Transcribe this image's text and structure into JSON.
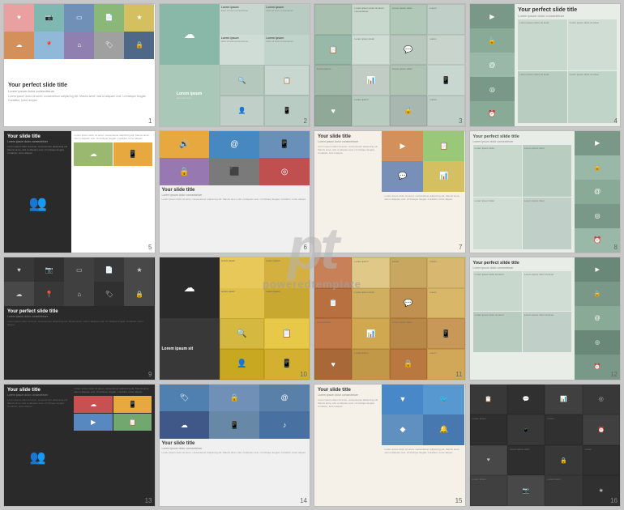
{
  "watermark": {
    "logo": "pt",
    "text": "poweredtemplate"
  },
  "slides": [
    {
      "num": "1",
      "title": "Your perfect slide title",
      "subtitle": "Lorem ipsum dolor consectetuer",
      "type": "icon-title"
    },
    {
      "num": "2",
      "title": "",
      "subtitle": "",
      "type": "cloud-text"
    },
    {
      "num": "3",
      "title": "",
      "subtitle": "",
      "type": "grid-icons"
    },
    {
      "num": "4",
      "title": "Your perfect slide title",
      "subtitle": "Lorem ipsum dolor consectetuer",
      "type": "vert-icon-title"
    },
    {
      "num": "5",
      "title": "Your slide title",
      "subtitle": "Lorem ipsum dolor consectetuer",
      "type": "two-col-dark"
    },
    {
      "num": "6",
      "title": "Your slide title",
      "subtitle": "Lorem ipsum dolor consectetuer",
      "type": "center-icons"
    },
    {
      "num": "7",
      "title": "Your slide title",
      "subtitle": "Lorem ipsum dolor consectetuer",
      "type": "two-col-light"
    },
    {
      "num": "8",
      "title": "",
      "subtitle": "",
      "type": "vert-icons-right"
    },
    {
      "num": "9",
      "title": "Your perfect slide title",
      "subtitle": "Lorem ipsum dolor consectetuer",
      "type": "dark-icon-title"
    },
    {
      "num": "10",
      "title": "",
      "subtitle": "",
      "type": "colorful-grid"
    },
    {
      "num": "11",
      "title": "",
      "subtitle": "",
      "type": "colorful-grid2"
    },
    {
      "num": "12",
      "title": "Your perfect slide title",
      "subtitle": "Lorem ipsum dolor consectetuer",
      "type": "vert-icon-title2"
    },
    {
      "num": "13",
      "title": "Your slide title",
      "subtitle": "Lorem ipsum dolor consectetuer",
      "type": "two-col-dark2"
    },
    {
      "num": "14",
      "title": "Your slide title",
      "subtitle": "Lorem ipsum dolor consectetuer",
      "type": "center-icons2"
    },
    {
      "num": "15",
      "title": "Your slide title",
      "subtitle": "Lorem ipsum dolor consectetuer",
      "type": "two-col-light2"
    },
    {
      "num": "16",
      "title": "",
      "subtitle": "",
      "type": "dark-grid"
    }
  ],
  "lorem": "Lorem ipsum dolor sit amet, consectetuer adipiscing elit. Mauris amet, wisi ut aliquam erat. Ut tristique feugiat. Curabitur, tortor aliquet.",
  "lorem_short": "Lorem ipsum dolor sit amet consectetuer",
  "lorem_tiny": "Lorem ipsum dolor sit amet, consectetuer adipiscing elit."
}
